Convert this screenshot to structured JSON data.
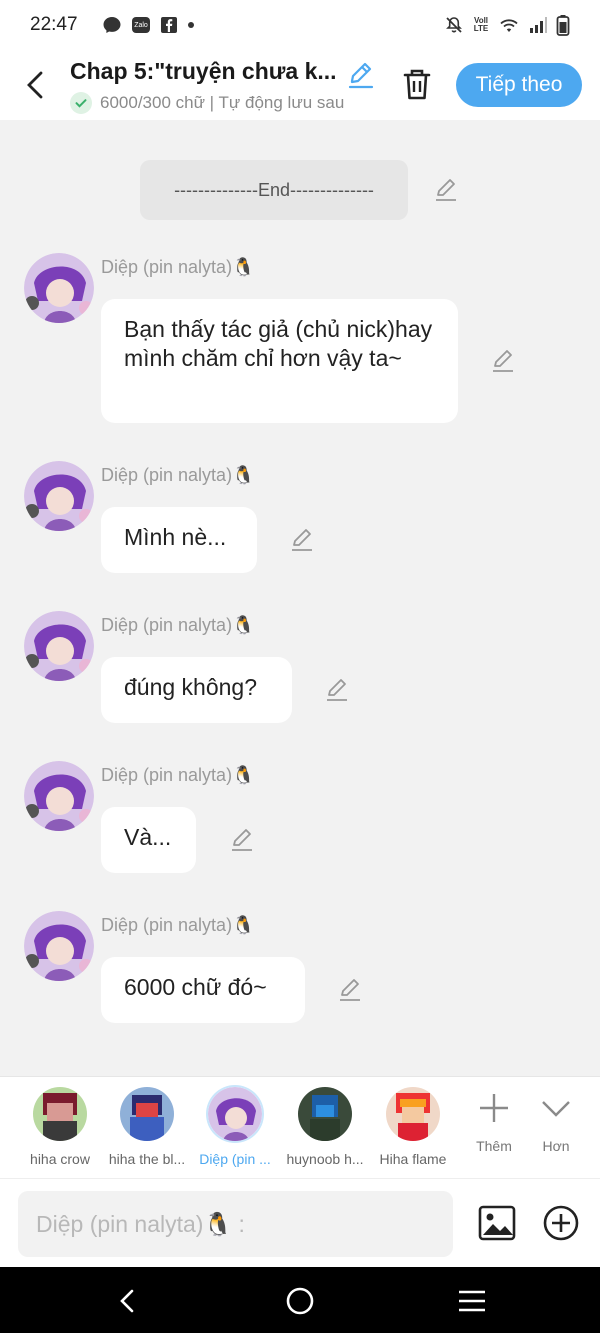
{
  "status_bar": {
    "time": "22:47",
    "zalo": "Zalo",
    "carrier": "Voll LTE"
  },
  "header": {
    "title": "Chap 5:\"truyện chưa k...",
    "subtitle": "6000/300 chữ | Tự động lưu sau",
    "next_label": "Tiếp theo"
  },
  "separator": {
    "text": "--------------End--------------"
  },
  "messages": [
    {
      "name": "Diệp (pin nalyta)🐧",
      "text": "Bạn thấy tác giả (chủ nick)hay mình chăm chỉ hơn vậy ta~"
    },
    {
      "name": "Diệp (pin nalyta)🐧",
      "text": "Mình nè..."
    },
    {
      "name": "Diệp (pin nalyta)🐧",
      "text": "đúng không?"
    },
    {
      "name": "Diệp (pin nalyta)🐧",
      "text": "Và..."
    },
    {
      "name": "Diệp (pin nalyta)🐧",
      "text": "6000 chữ đó~"
    }
  ],
  "characters": [
    {
      "name": "hiha crow"
    },
    {
      "name": "hiha the bl..."
    },
    {
      "name": "Diệp (pin ..."
    },
    {
      "name": "huynoob h..."
    },
    {
      "name": "Hiha flame"
    }
  ],
  "char_actions": {
    "more": "Thêm",
    "expand": "Hơn"
  },
  "input": {
    "placeholder": "Diệp (pin nalyta)🐧 :"
  },
  "colors": {
    "accent": "#4da8f0",
    "background": "#f2f2f2",
    "bubble": "#ffffff"
  }
}
